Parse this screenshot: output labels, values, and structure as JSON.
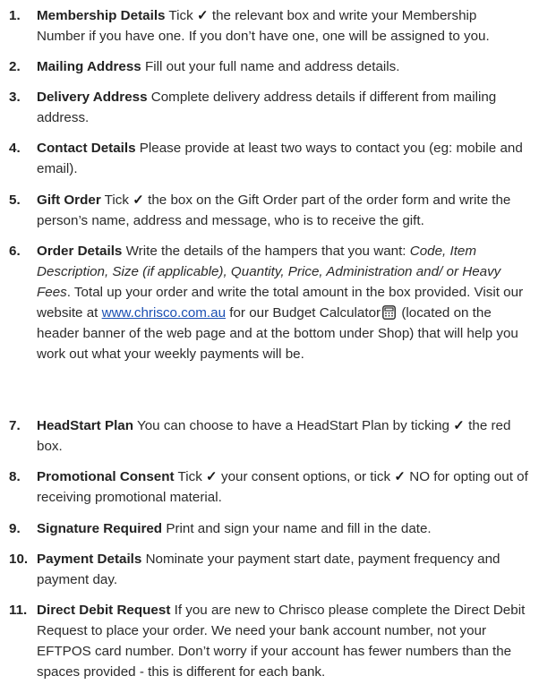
{
  "items": [
    {
      "num": "1.",
      "title": "Membership Details",
      "a": " Tick ",
      "tick": "✓",
      "b": " the relevant box and write your Membership Number if you have one. If you don’t have one, one will be assigned to you."
    },
    {
      "num": "2.",
      "title": "Mailing Address",
      "a": " Fill out your full name and address details."
    },
    {
      "num": "3.",
      "title": "Delivery Address",
      "a": " Complete delivery address details if different from mailing address."
    },
    {
      "num": "4.",
      "title": "Contact Details",
      "a": " Please provide at least two ways to contact you (eg: mobile and email)."
    },
    {
      "num": "5.",
      "title": "Gift Order",
      "a": " Tick ",
      "tick": "✓",
      "b": " the box on the Gift Order part of the order form and write the person’s name, address and message, who is to receive the gift."
    },
    {
      "num": "6.",
      "title": "Order Details",
      "a": " Write the details of the hampers that you want: ",
      "italic": "Code, Item Description, Size (if applicable), Quantity, Price, Administration and/ or Heavy Fees",
      "b": ". Total up your order and write the total amount in the box provided. Visit our website at ",
      "link": "www.chrisco.com.au",
      "c": " for our Budget Calculator",
      "d": " (located on the header banner of the web page and at the bottom under Shop) that will help you work out what your weekly payments will be."
    },
    {
      "num": "7.",
      "title": "HeadStart Plan",
      "a": " You can choose to have a HeadStart Plan by ticking ",
      "tick": "✓",
      "b": " the red box."
    },
    {
      "num": "8.",
      "title": "Promotional Consent",
      "a": " Tick ",
      "tick": "✓",
      "b": " your consent options, or tick ",
      "tick2": "✓",
      "c": " NO for opting out of receiving promotional material."
    },
    {
      "num": "9.",
      "title": "Signature Required",
      "a": " Print and sign your name and fill in the date."
    },
    {
      "num": "10.",
      "title": "Payment Details",
      "a": " Nominate your payment start date, payment frequency and payment day."
    },
    {
      "num": "11.",
      "title": "Direct Debit Request",
      "a": " If you are new to Chrisco please complete the Direct Debit Request to place your order. We need your bank account number, not your EFTPOS card number. Don’t worry if your account has fewer numbers than the spaces provided - this is different for each bank."
    }
  ]
}
